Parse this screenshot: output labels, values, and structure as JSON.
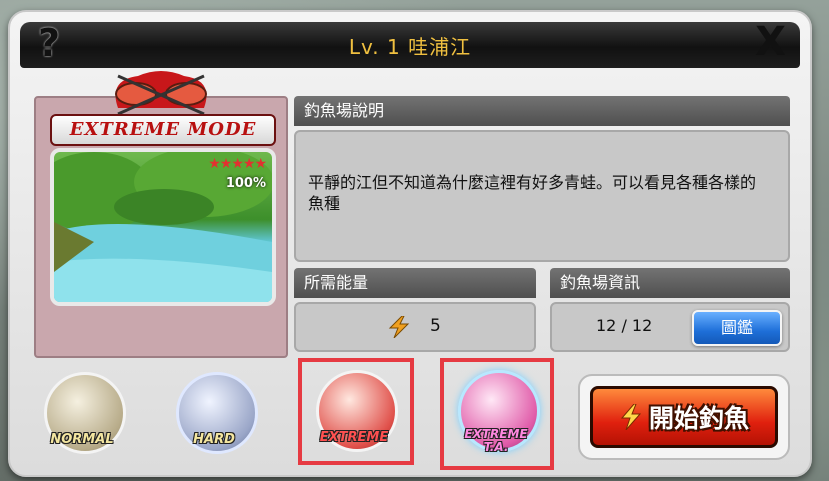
{
  "window": {
    "title": "Lv. 1 哇浦江",
    "help_label": "?",
    "close_label": "X"
  },
  "mode_panel": {
    "banner": "EXTREME MODE",
    "rating": "★★★★★",
    "completion": "100%"
  },
  "description": {
    "header": "釣魚場說明",
    "text": "平靜的江但不知道為什麼這裡有好多青蛙。可以看見各種各樣的魚種"
  },
  "energy": {
    "header": "所需能量",
    "value": "5",
    "icon": "lightning-icon"
  },
  "info": {
    "header": "釣魚場資訊",
    "progress": "12 / 12",
    "atlas_button": "圖鑑"
  },
  "modes": [
    {
      "label": "NORMAL",
      "color": "#a89a70"
    },
    {
      "label": "HARD",
      "color": "#8d98b4"
    },
    {
      "label": "EXTREME",
      "color": "#e0504a"
    },
    {
      "label": "EXTREME T.A.",
      "color": "#e05aa8"
    }
  ],
  "start": {
    "label": "開始釣魚"
  },
  "colors": {
    "title": "#f0c040",
    "highlight": "#e63a42",
    "start": "#e0200e",
    "atlas": "#1e6fd8"
  }
}
